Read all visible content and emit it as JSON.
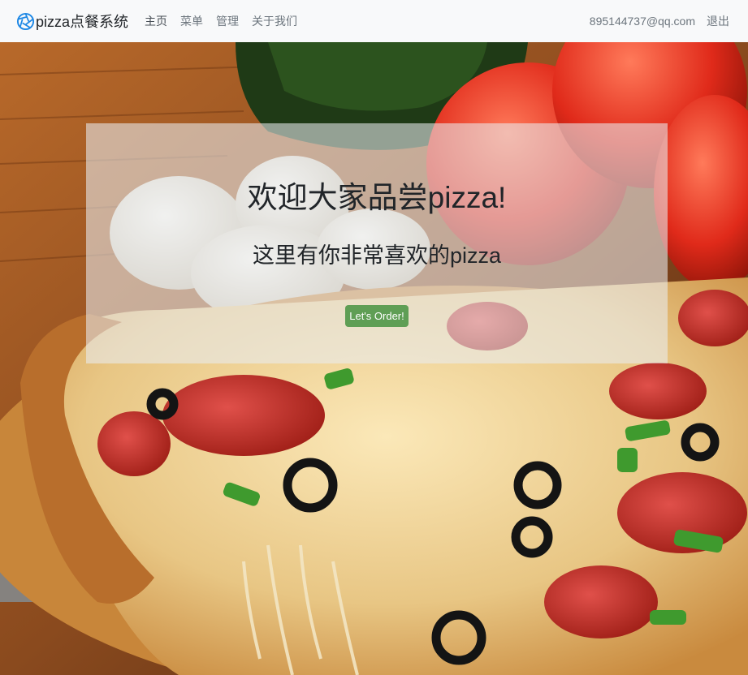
{
  "navbar": {
    "brand_icon": "aperture-logo-icon",
    "brand": "pizza点餐系统",
    "links": [
      {
        "label": "主页"
      },
      {
        "label": "菜单"
      },
      {
        "label": "管理"
      },
      {
        "label": "关于我们"
      }
    ],
    "user_email": "895144737@qq.com",
    "logout_label": "退出"
  },
  "jumbotron": {
    "title": "欢迎大家品尝pizza!",
    "subtitle": "这里有你非常喜欢的pizza",
    "button_label": "Let's Order!"
  },
  "colors": {
    "navbar_bg": "#f8f9fa",
    "button_bg": "#5f9e55",
    "brand_icon": "#1e88e5"
  }
}
